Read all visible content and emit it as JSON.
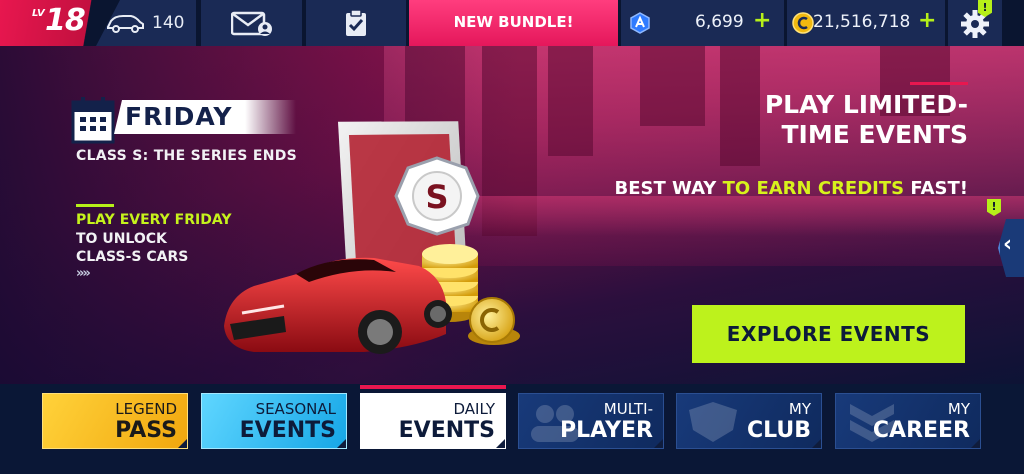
{
  "topbar": {
    "level_prefix": "LV",
    "level": "18",
    "cars_owned": "140",
    "bundle_label": "NEW BUNDLE!",
    "tokens": "6,699",
    "credits": "21,516,718",
    "plus_symbol": "+",
    "alert_symbol": "!"
  },
  "banner": {
    "day": "FRIDAY",
    "event_title": "CLASS S: THE SERIES ENDS",
    "promo_line1": "PLAY EVERY FRIDAY",
    "promo_line2": "TO UNLOCK",
    "promo_line3": "CLASS-S CARS",
    "more_arrows": "»»",
    "headline_line1": "PLAY LIMITED-",
    "headline_line2": "TIME EVENTS",
    "tagline_part1": "BEST WAY ",
    "tagline_part2": "TO EARN CREDITS",
    "tagline_part3": " FAST!",
    "class_badge": "S",
    "explore_button": "EXPLORE EVENTS",
    "side_tab_arrow": "‹"
  },
  "nav": {
    "legend": {
      "line1": "LEGEND",
      "line2": "PASS"
    },
    "seasonal": {
      "line1": "SEASONAL",
      "line2": "EVENTS"
    },
    "daily": {
      "line1": "DAILY",
      "line2": "EVENTS"
    },
    "multi": {
      "line1": "MULTI-",
      "line2": "PLAYER"
    },
    "club": {
      "line1": "MY",
      "line2": "CLUB"
    },
    "career": {
      "line1": "MY",
      "line2": "CAREER"
    }
  },
  "colors": {
    "accent_red": "#e8174f",
    "bundle_pink": "#ff3d7e",
    "lime": "#bdf21c",
    "legend_gold": "#ffd23a",
    "seasonal_cyan": "#5fd6ff",
    "nav_blue": "#183a7a"
  },
  "icons": {
    "car": "car-icon",
    "mail": "mail-icon",
    "tasks": "clipboard-check-icon",
    "token": "token-icon",
    "credit": "credit-coin-icon",
    "settings": "gear-icon",
    "calendar": "calendar-icon"
  }
}
